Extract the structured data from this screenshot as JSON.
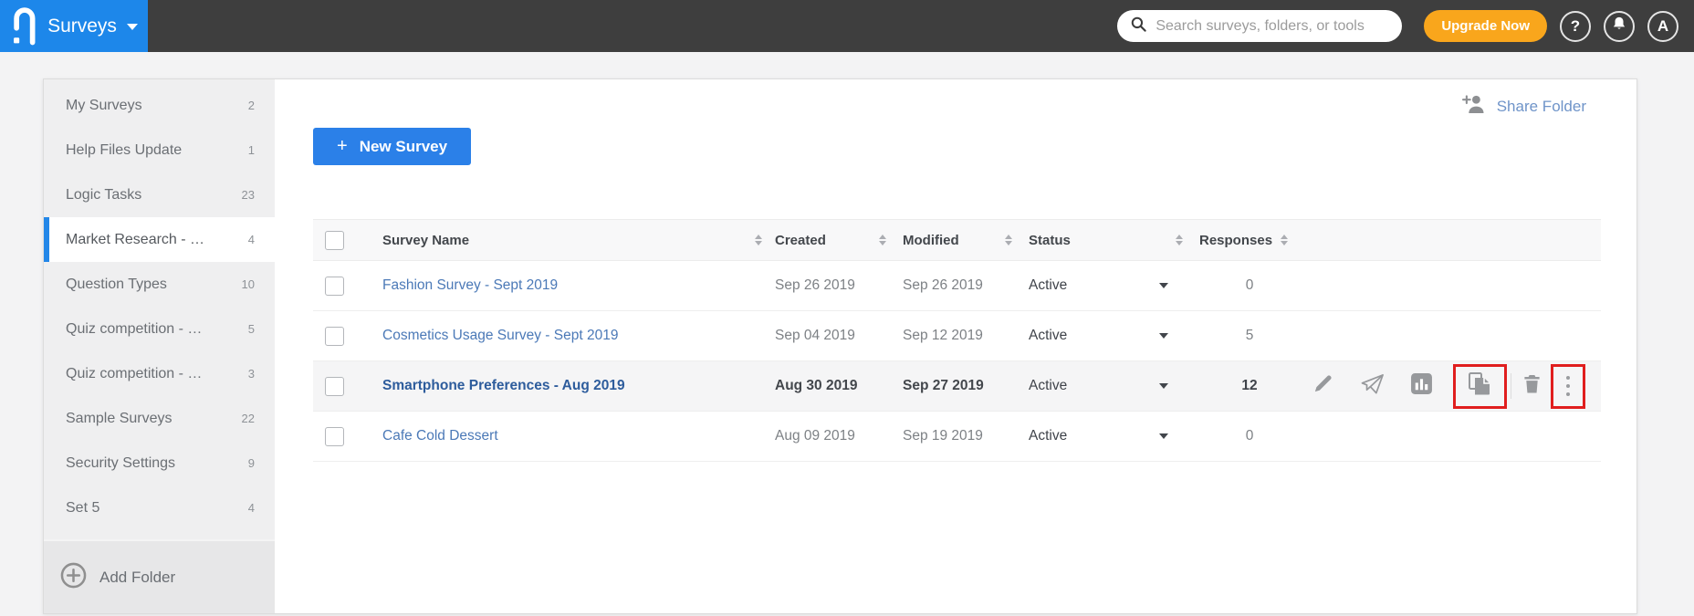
{
  "header": {
    "app_name": "Surveys",
    "search_placeholder": "Search surveys, folders, or tools",
    "upgrade_label": "Upgrade Now",
    "help_glyph": "?",
    "avatar_glyph": "A"
  },
  "sidebar": {
    "items": [
      {
        "label": "My Surveys",
        "count": "2"
      },
      {
        "label": "Help Files Update",
        "count": "1"
      },
      {
        "label": "Logic Tasks",
        "count": "23"
      },
      {
        "label": "Market Research - …",
        "count": "4"
      },
      {
        "label": "Question Types",
        "count": "10"
      },
      {
        "label": "Quiz competition - …",
        "count": "5"
      },
      {
        "label": "Quiz competition - …",
        "count": "3"
      },
      {
        "label": "Sample Surveys",
        "count": "22"
      },
      {
        "label": "Security Settings",
        "count": "9"
      },
      {
        "label": "Set 5",
        "count": "4"
      }
    ],
    "add_folder_label": "Add Folder"
  },
  "main": {
    "share_folder_label": "Share Folder",
    "new_survey": {
      "plus": "+",
      "label": "New Survey"
    },
    "table": {
      "columns": {
        "name": "Survey Name",
        "created": "Created",
        "modified": "Modified",
        "status": "Status",
        "responses": "Responses"
      },
      "rows": [
        {
          "name": "Fashion Survey - Sept 2019",
          "created": "Sep 26 2019",
          "modified": "Sep 26 2019",
          "status": "Active",
          "responses": "0"
        },
        {
          "name": "Cosmetics Usage Survey - Sept 2019",
          "created": "Sep 04 2019",
          "modified": "Sep 12 2019",
          "status": "Active",
          "responses": "5"
        },
        {
          "name": "Smartphone Preferences - Aug 2019",
          "created": "Aug 30 2019",
          "modified": "Sep 27 2019",
          "status": "Active",
          "responses": "12"
        },
        {
          "name": "Cafe Cold Dessert",
          "created": "Aug 09 2019",
          "modified": "Sep 19 2019",
          "status": "Active",
          "responses": "0"
        }
      ]
    }
  },
  "colors": {
    "topbar": "#3e3e3e",
    "logo_blue": "#1d87ea",
    "accent_blue": "#2b80e8",
    "upgrade_orange": "#f9a61c",
    "highlight_red": "#e01e1e",
    "link_blue": "#4b79b7",
    "emphasized_link": "#2d5c9c",
    "selected_bar_blue": "#2387e8"
  }
}
